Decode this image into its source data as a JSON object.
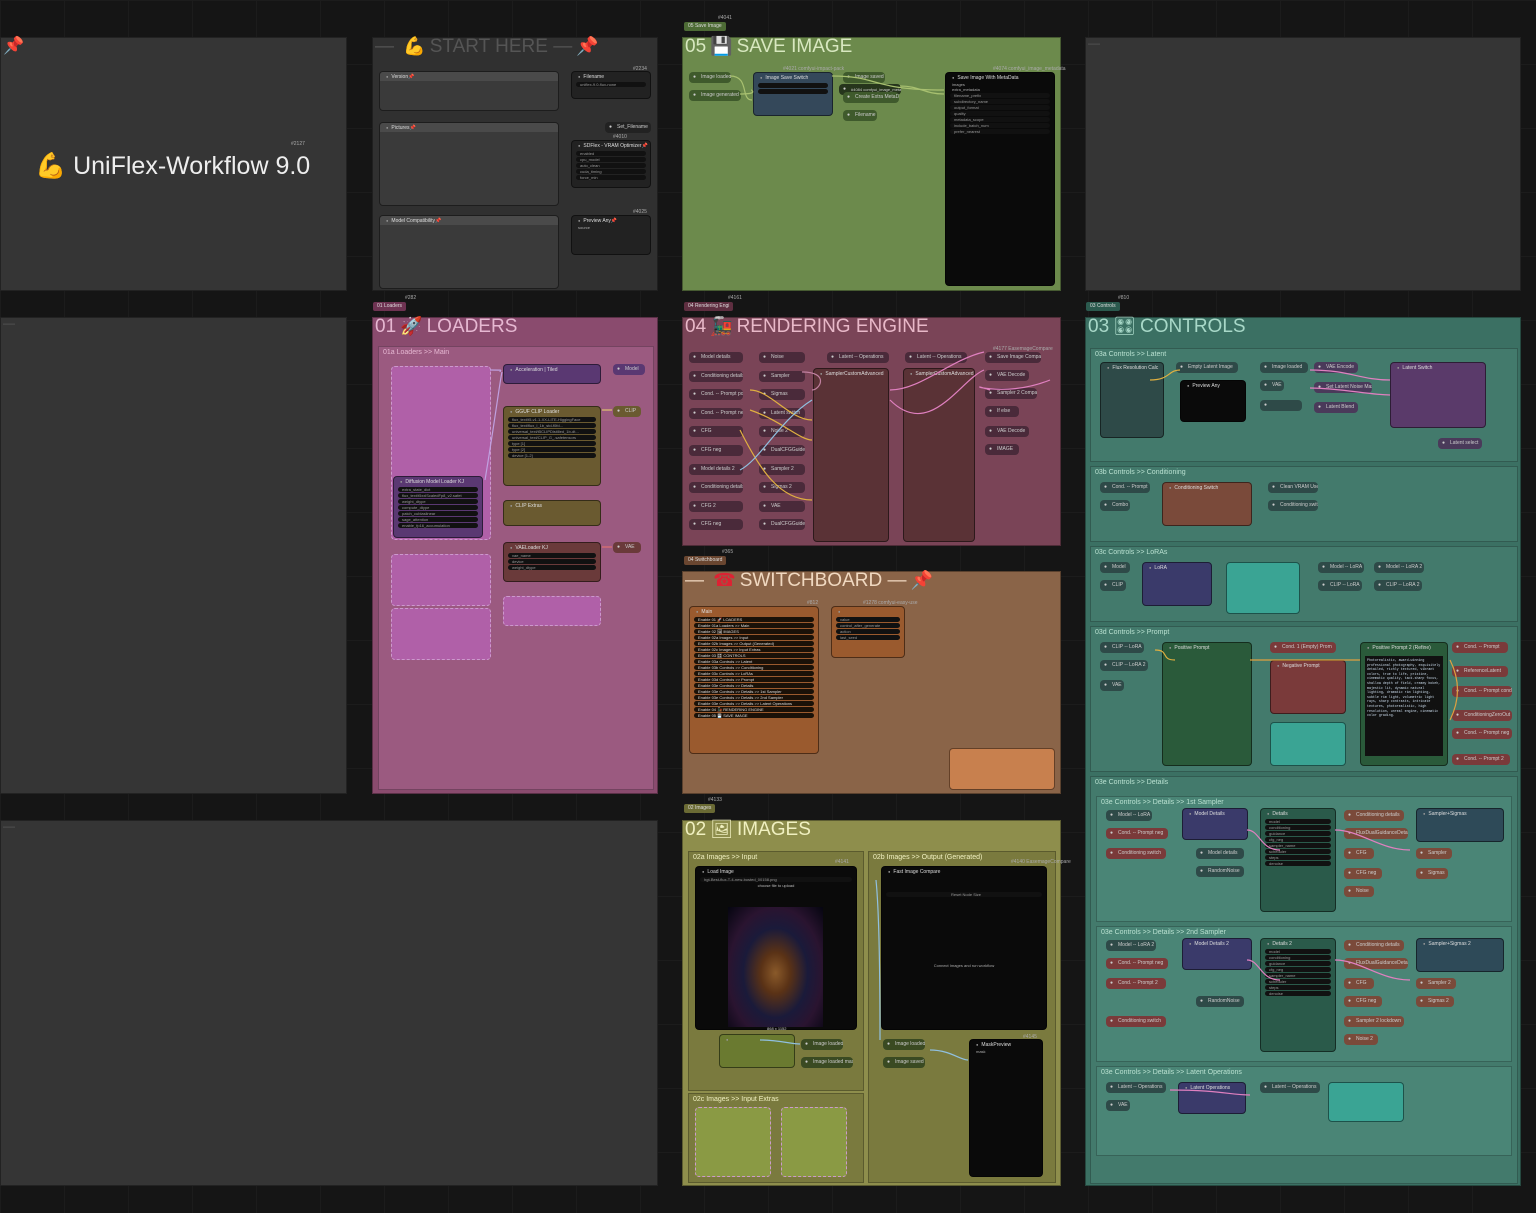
{
  "colors": {
    "save": "#6c8a4c",
    "loaders": "#8a4b6e",
    "render": "#7a4457",
    "switch": "#8a6448",
    "images": "#8e8e4c",
    "controls": "#3b7063"
  },
  "header": {
    "title": "UniFlex-Workflow 9.0",
    "gid": "#2127"
  },
  "start": {
    "title": "START HERE",
    "nodes": {
      "version": "Version📌",
      "pictures": "Pictures📌",
      "compat": "Model Compatibility📌",
      "filename": "Filename",
      "filename_val": "uniflex-9.0-flux-none",
      "set_filename": "Set_Filename",
      "sdflex": "SDFlex - VRAM Optimizer📌",
      "sdf_rows": [
        "enabled",
        "cpu_model",
        "auto_clean",
        "cuda_timing",
        "force_min"
      ],
      "preview": "Preview Any📌",
      "source": "source",
      "ids": [
        "#2234",
        "#4010",
        "#4025"
      ]
    }
  },
  "save": {
    "title": "SAVE IMAGE",
    "number": "05",
    "tag": "05 Save Image",
    "gid": "#4041",
    "nodes": {
      "image_loaded": "Image loaded",
      "image_generated": "Image generated",
      "switch": "Image Save Switch",
      "switch_id": "#4021 comfyui-impact-pack",
      "image_saved": "Image saved",
      "metadata": "#4084 comfyui_image_metadata",
      "create_extra": "Create Extra MetaData",
      "filename": "Filename",
      "save_meta": "Save Image With MetaData",
      "save_meta_id": "#4074 comfyui_image_metadata",
      "rows": [
        "images",
        "extra_metadata",
        "filename_prefix",
        "subdirectory_name",
        "output_format",
        "quality",
        "metadata_scope",
        "include_batch_num",
        "prefer_nearest"
      ]
    }
  },
  "loaders": {
    "title": "LOADERS",
    "number": "01",
    "tag": "01 Loaders",
    "gid": "#282",
    "sub": "01a Loaders >> Main",
    "nodes": {
      "accel": "Acceleration | Tiled",
      "model": "Model",
      "gguf": "GGUF CLIP Loader",
      "clip": "CLIP",
      "clip_extras": "CLIP Extras",
      "diff": "Diffusion Model Loader KJ",
      "vae_loader": "VAELoader KJ",
      "vae": "VAE",
      "gguf_rows": [
        "flux_text/t5-v1.1-XX-LITE-HiggingFace",
        "flux_text/flux_l_1b_std-f0fd...",
        "universal_text/t5CLIPDistilled_1b-dt...",
        "universal_text/CLIP_G_.safetensors",
        "type [1]",
        "type [2]",
        "device [1-2]"
      ],
      "diff_rows": [
        "extra_state_dict",
        "flux_text/t5xxlScaledFp8_v2.safet",
        "weight_dtype",
        "compute_dtype",
        "patch_cublaslinear",
        "sage_attention",
        "enable_fp16_accumulation"
      ],
      "vae_rows": [
        "vae_name",
        "device",
        "weight_dtype"
      ],
      "ids": [
        "#4035",
        "#3914",
        "#4025",
        "#4280",
        "#4288"
      ]
    }
  },
  "render": {
    "title": "RENDERING ENGINE",
    "number": "04",
    "tag": "04 Rendering Engi",
    "gid": "#4161",
    "inputs": [
      "Model details",
      "Conditioning details",
      "Cond. -- Prompt pos",
      "Cond. -- Prompt neg",
      "CFG",
      "CFG neg",
      "Model details 2",
      "Conditioning details",
      "CFG 2",
      "CFG neg"
    ],
    "mids": [
      "Noise",
      "Sampler",
      "Sigmas",
      "Latent switch",
      "Noise 2",
      "DualCFGGuider",
      "Sampler 2",
      "Sigmas 2",
      "VAE",
      "DualCFGGuider"
    ],
    "nodes": {
      "lat1": "Latent -- Operations",
      "lat2": "Latent -- Operations",
      "adv1": "SamplerCustomAdvanced",
      "adv2": "SamplerCustomAdvanced 2",
      "compare": "Save Image Compare",
      "vae_decode": "VAE Decode",
      "sampler_cmp": "Sampler 2 Compare",
      "ifelse": "If else",
      "vae_decode2": "VAE Decode",
      "image": "IMAGE",
      "compare_id": "#4177 EasemageCompare"
    }
  },
  "switch": {
    "title": "SWITCHBOARD",
    "tag": "04 Switchboard",
    "gid": "#365",
    "main": "Main",
    "main_id": "#812",
    "seed_id": "#1278 comfyui-easy-use",
    "rows": [
      "Enable 01 🚀 LOADERS",
      "Enable 01a Loaders >> Main",
      "Enable 02 🖼 IMAGES",
      "Enable 02a Images >> Input",
      "Enable 02b Images >> Output (Generated)",
      "Enable 02c Images >> Input Extras",
      "Enable 03 🎛 CONTROLS",
      "Enable 03a Controls >> Latent",
      "Enable 03b Controls >> Conditioning",
      "Enable 03c Controls >> LoRAs",
      "Enable 03d Controls >> Prompt",
      "Enable 03e Controls >> Details",
      "Enable 03e Controls >> Details >> 1st Sampler",
      "Enable 03e Controls >> Details >> 2nd Sampler",
      "Enable 03e Controls >> Details >> Latent Operations",
      "Enable 04 🚂 RENDERING ENGINE",
      "Enable 05 💾 SAVE IMAGE"
    ],
    "seed_rows": [
      "value",
      "control_after_generate",
      "action",
      "last_seed"
    ],
    "seed_vals": [
      "631735783574288",
      "",
      "randomize",
      "875456657564736"
    ]
  },
  "images": {
    "title": "IMAGES",
    "number": "02",
    "tag": "02 Images",
    "gid": "#4133",
    "sub_a": "02a Images >> Input",
    "sub_b": "02b Images >> Output (Generated)",
    "sub_c": "02c Images >> Input Extras",
    "nodes": {
      "load": "Load Image",
      "load_file": "hgt-Best-flux-T-4-new-bosted_00158.png",
      "upload": "choose file to upload",
      "compare": "Fast Image Compare",
      "reset": "Reset Node Size",
      "connect": "Connect Images and run workflow",
      "image_loaded": "Image loaded",
      "image_saved": "Image saved",
      "preview": "MaskPreview",
      "mask": "mask",
      "img_loaded_mask": "Image loaded mask",
      "img_loaded": "Image loaded",
      "size": "868 x 1152",
      "ids": [
        "#4141",
        "#4140 EasemageCompare",
        "#4050",
        "#4145"
      ]
    }
  },
  "controls": {
    "title": "CONTROLS",
    "number": "03",
    "tag": "03 Controls",
    "gid": "#810",
    "subs": {
      "a": "03a Controls >> Latent",
      "b": "03b Controls >> Conditioning",
      "c": "03c Controls >> LoRAs",
      "d": "03d Controls >> Prompt",
      "e": "03e Controls >> Details",
      "e1": "03e Controls >> Details >> 1st Sampler",
      "e2": "03e Controls >> Details >> 2nd Sampler",
      "e3": "03e Controls >> Details >> Latent Operations"
    },
    "nodes": {
      "flux_res": "Flux Resolution Calc",
      "empty_latent": "Empty Latent Image",
      "image_loaded": "Image loaded",
      "vae_encode": "VAE Encode",
      "latent_switch": "Latent Switch",
      "preview_any": "Preview Any",
      "set_latent": "Set Latent Noise Mask",
      "latent_blend": "Latent Blend",
      "latent_select": "Latent select",
      "vae": "VAE",
      "cond_prompt": "Cond. -- Prompt",
      "combo": "Combo",
      "cond_switch": "Conditioning Switch",
      "clean_vram": "Clean VRAM Used",
      "cond_switch2": "Conditioning switch",
      "model": "Model",
      "clip": "CLIP",
      "lora": "LoRA",
      "model_lora": "Model -- LoRA",
      "clip_lora": "CLIP -- LoRA",
      "model_lora2": "Model -- LoRA 2",
      "clip_lora2": "CLIP -- LoRA 2",
      "pos_prompt": "Positive Prompt",
      "neg_prompt": "Negative Prompt",
      "pos_prompt2": "Positive Prompt 2 (Refine)",
      "ref_latent": "ReferenceLatent",
      "cond_pos": "Cond. -- Prompt",
      "cond_pos_cond": "Cond. -- Prompt cond",
      "cond_zero": "ConditioningZeroOut",
      "cond_neg": "Cond. -- Prompt neg",
      "cond_pos2": "Cond. -- Prompt 2",
      "guid": "Cond. 1 (Empty) Prom",
      "prompt_text": "Photorealistic, award-winning professional photography, exquisitely detailed, richly textured, vibrant colors, true to life, pristine, cinematic quality, tack-sharp focus, shallow depth of field, creamy bokeh, majestic lit, dynamic natural lighting, dramatic rim lighting, subtle rim light, volumetric light rays, sharp contrasts, intricate textures, photorealistic, high resolution, unreal engine, cinematic color grading.",
      "model_details": "Model Details",
      "cond_details": "Conditioning details",
      "sampler_sigmas": "Sampler+Sigmas",
      "details": "Details",
      "flux_guid": "FluxDualGuidanceDetails",
      "cfg": "CFG",
      "cfg_neg": "CFG neg",
      "noise": "Noise",
      "random_noise": "RandomNoise",
      "model_details_n": "Model details",
      "sampler": "Sampler",
      "sigmas": "Sigmas",
      "model_details2": "Model Details 2",
      "details2": "Details 2",
      "sampler_sigmas2": "Sampler+Sigmas 2",
      "noise2": "Noise 2",
      "sampler2": "Sampler 2",
      "sigmas2": "Sigmas 2",
      "sampler2_lockdown": "Sampler 2 lockdown",
      "lat_ops": "Latent -- Operations",
      "latent_ops": "Latent Operations",
      "lat_ops_out": "Latent -- Operations",
      "detail_rows": [
        "model",
        "conditioning",
        "guidance",
        "cfg_neg",
        "sampler_name",
        "scheduler",
        "steps",
        "denoise"
      ]
    }
  }
}
